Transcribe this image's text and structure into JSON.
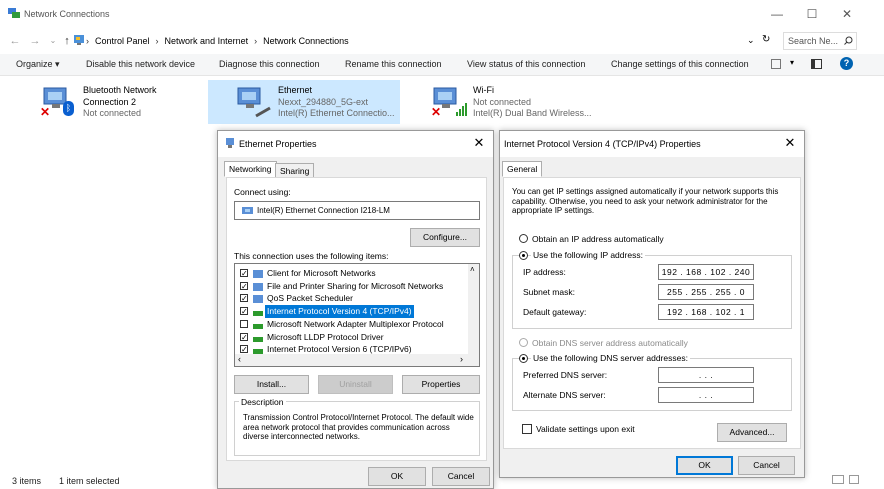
{
  "window": {
    "title": "Network Connections",
    "controls": {
      "minimize": "—",
      "maximize": "☐",
      "close": "✕"
    }
  },
  "address": {
    "breadcrumbs": [
      "Control Panel",
      "Network and Internet",
      "Network Connections"
    ],
    "search_placeholder": "Search Ne..."
  },
  "toolbar": {
    "organize": "Organize ▾",
    "items": [
      "Disable this network device",
      "Diagnose this connection",
      "Rename this connection",
      "View status of this connection",
      "Change settings of this connection"
    ]
  },
  "connections": [
    {
      "name": "Bluetooth Network Connection 2",
      "line1": "Bluetooth Network",
      "line2": "Connection 2",
      "status": "Not connected"
    },
    {
      "name": "Ethernet",
      "network": "Nexxt_294880_5G-ext",
      "adapter": "Intel(R) Ethernet Connectio..."
    },
    {
      "name": "Wi-Fi",
      "status": "Not connected",
      "adapter": "Intel(R) Dual Band Wireless..."
    }
  ],
  "statusbar": {
    "items": "3 items",
    "selected": "1 item selected"
  },
  "eth_dialog": {
    "title": "Ethernet Properties",
    "tabs": [
      "Networking",
      "Sharing"
    ],
    "connect_using_label": "Connect using:",
    "adapter": "Intel(R) Ethernet Connection I218-LM",
    "configure": "Configure...",
    "items_label": "This connection uses the following items:",
    "items": [
      {
        "label": "Client for Microsoft Networks",
        "checked": true
      },
      {
        "label": "File and Printer Sharing for Microsoft Networks",
        "checked": true
      },
      {
        "label": "QoS Packet Scheduler",
        "checked": true
      },
      {
        "label": "Internet Protocol Version 4 (TCP/IPv4)",
        "checked": true,
        "selected": true
      },
      {
        "label": "Microsoft Network Adapter Multiplexor Protocol",
        "checked": false
      },
      {
        "label": "Microsoft LLDP Protocol Driver",
        "checked": true
      },
      {
        "label": "Internet Protocol Version 6 (TCP/IPv6)",
        "checked": true
      }
    ],
    "install": "Install...",
    "uninstall": "Uninstall",
    "properties": "Properties",
    "description_label": "Description",
    "description": "Transmission Control Protocol/Internet Protocol. The default wide area network protocol that provides communication across diverse interconnected networks.",
    "ok": "OK",
    "cancel": "Cancel"
  },
  "ipv4_dialog": {
    "title": "Internet Protocol Version 4 (TCP/IPv4) Properties",
    "tab": "General",
    "intro": "You can get IP settings assigned automatically if your network supports this capability. Otherwise, you need to ask your network administrator for the appropriate IP settings.",
    "obtain_ip_auto": "Obtain an IP address automatically",
    "use_following_ip": "Use the following IP address:",
    "ip_label": "IP address:",
    "ip_value": "192 . 168 . 102 . 240",
    "subnet_label": "Subnet mask:",
    "subnet_value": "255 . 255 . 255 .  0",
    "gateway_label": "Default gateway:",
    "gateway_value": "192 . 168 . 102 .  1",
    "obtain_dns_auto": "Obtain DNS server address automatically",
    "use_following_dns": "Use the following DNS server addresses:",
    "preferred_dns_label": "Preferred DNS server:",
    "preferred_dns_value": ".      .      .",
    "alternate_dns_label": "Alternate DNS server:",
    "alternate_dns_value": ".      .      .",
    "validate": "Validate settings upon exit",
    "advanced": "Advanced...",
    "ok": "OK",
    "cancel": "Cancel"
  },
  "colors": {
    "accent": "#0078d7",
    "selection": "#cce8ff",
    "selected_row": "#0078d7"
  }
}
